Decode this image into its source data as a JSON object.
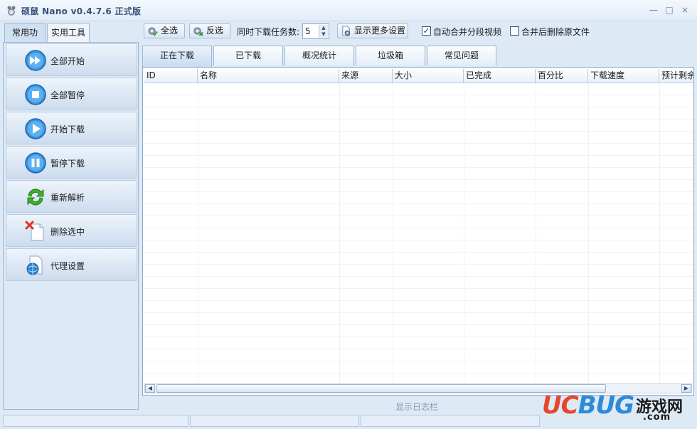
{
  "window": {
    "title": "硕鼠 Nano v0.4.7.6 正式版",
    "controls": {
      "minimize": "—",
      "maximize": "□",
      "close": "×"
    }
  },
  "left": {
    "tabs": [
      "常用功能",
      "实用工具"
    ],
    "buttons": [
      {
        "label": "全部开始",
        "icon": "double-play-icon"
      },
      {
        "label": "全部暂停",
        "icon": "stop-icon"
      },
      {
        "label": "开始下载",
        "icon": "play-icon"
      },
      {
        "label": "暂停下载",
        "icon": "pause-icon"
      },
      {
        "label": "重新解析",
        "icon": "refresh-icon"
      },
      {
        "label": "删除选中",
        "icon": "delete-file-icon"
      },
      {
        "label": "代理设置",
        "icon": "proxy-globe-icon"
      }
    ]
  },
  "toolbar": {
    "select_all": "全选",
    "invert_select": "反选",
    "concurrent_label": "同时下载任务数:",
    "concurrent_value": "5",
    "more_settings": "显示更多设置",
    "auto_merge": {
      "label": "自动合并分段视频",
      "checked": true
    },
    "delete_after_merge": {
      "label": "合并后删除原文件",
      "checked": false
    }
  },
  "tabs": [
    "正在下载",
    "已下载",
    "概况统计",
    "垃圾箱",
    "常见问题"
  ],
  "grid": {
    "columns": [
      "ID",
      "名称",
      "来源",
      "大小",
      "已完成",
      "百分比",
      "下载速度",
      "预计剩余"
    ],
    "rows": []
  },
  "log_bar": "显示日志栏",
  "watermark": {
    "uc": "UC",
    "bug": "BUG",
    "cn": "游戏网",
    "com": ".com"
  },
  "colors": {
    "accent": "#2d8ad8",
    "panel": "#dce9f6",
    "border": "#9fb7d3"
  }
}
